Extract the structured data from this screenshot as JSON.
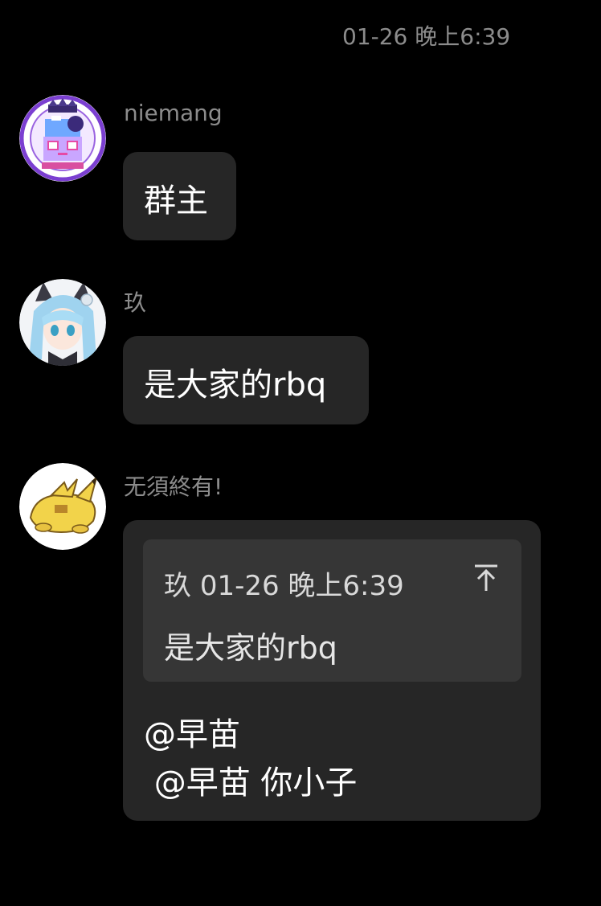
{
  "timestamp": "01-26 晚上6:39",
  "messages": [
    {
      "sender": "niemang",
      "avatar": "crown-pixel-avatar-icon",
      "text": "群主"
    },
    {
      "sender": "玖",
      "avatar": "anime-catgirl-avatar-icon",
      "text": "是大家的rbq"
    },
    {
      "sender": "无須終有!",
      "avatar": "pikachu-avatar-icon",
      "quote": {
        "author": "玖",
        "time": "01-26 晚上6:39",
        "text": "是大家的rbq",
        "icon": "jump-to-message-icon"
      },
      "lines": [
        "@早苗",
        " @早苗 你小子"
      ]
    }
  ],
  "colors": {
    "background": "#000000",
    "bubble": "#262626",
    "quote": "#363636",
    "muted_text": "#8c8c8c"
  }
}
